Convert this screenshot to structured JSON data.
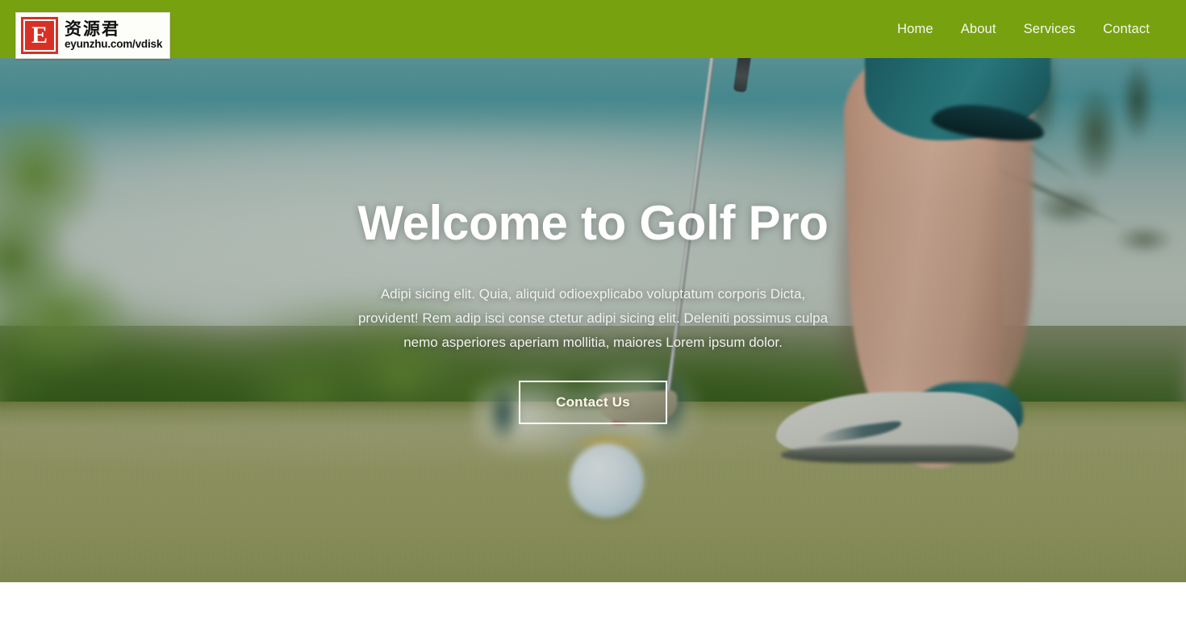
{
  "site": {
    "title": "Golf Pro",
    "accent_color": "#78a110",
    "hero_text_color": "#ffffff"
  },
  "watermark": {
    "name": "eyunzhu-watermark",
    "badge_letter": "E",
    "badge_color": "#d93025",
    "chinese_text": "资源君",
    "url_text": "eyunzhu.com/vdisk"
  },
  "header": {
    "nav": [
      {
        "label": "Home",
        "name": "nav-link-home"
      },
      {
        "label": "About",
        "name": "nav-link-about"
      },
      {
        "label": "Services",
        "name": "nav-link-services"
      },
      {
        "label": "Contact",
        "name": "nav-link-contact"
      }
    ]
  },
  "hero": {
    "heading": "Welcome to Golf Pro",
    "paragraph": "Adipi sicing elit. Quia, aliquid odioexplicabo voluptatum corporis Dicta, provident! Rem adip isci conse ctetur adipi sicing elit. Deleniti possimus culpa nemo asperiores aperiam mollitia, maiores Lorem ipsum dolor.",
    "cta_label": "Contact Us",
    "background_description": "golfer putting on a green, blurred golf ball in foreground"
  }
}
